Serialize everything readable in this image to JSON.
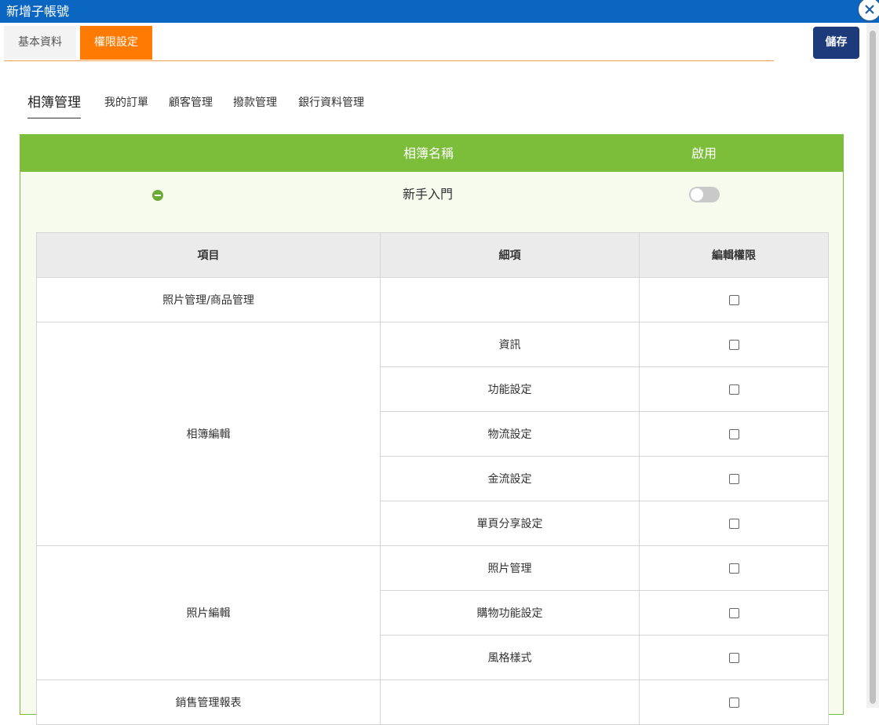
{
  "window": {
    "title": "新增子帳號"
  },
  "tabs": [
    {
      "label": "基本資料",
      "active": false
    },
    {
      "label": "權限設定",
      "active": true
    }
  ],
  "toolbar": {
    "save_label": "儲存"
  },
  "subtabs": [
    {
      "label": "相簿管理",
      "active": true
    },
    {
      "label": "我的訂單",
      "active": false
    },
    {
      "label": "顧客管理",
      "active": false
    },
    {
      "label": "撥款管理",
      "active": false
    },
    {
      "label": "銀行資料管理",
      "active": false
    }
  ],
  "album_table": {
    "header_name": "相簿名稱",
    "header_enable": "啟用",
    "album": {
      "name": "新手入門",
      "enabled": false
    }
  },
  "permissions": {
    "headers": {
      "item": "項目",
      "detail": "細項",
      "edit": "編輯權限"
    },
    "rows": [
      {
        "item": "照片管理/商品管理",
        "detail": "",
        "checked": false
      },
      {
        "item": "相簿編輯",
        "detail": "資訊",
        "checked": false
      },
      {
        "item": "",
        "detail": "功能設定",
        "checked": false
      },
      {
        "item": "",
        "detail": "物流設定",
        "checked": false
      },
      {
        "item": "",
        "detail": "金流設定",
        "checked": false
      },
      {
        "item": "",
        "detail": "單頁分享設定",
        "checked": false
      },
      {
        "item": "照片編輯",
        "detail": "照片管理",
        "checked": false
      },
      {
        "item": "",
        "detail": "購物功能設定",
        "checked": false
      },
      {
        "item": "",
        "detail": "風格樣式",
        "checked": false
      },
      {
        "item": "銷售管理報表",
        "detail": "",
        "checked": false
      }
    ]
  },
  "colors": {
    "titlebar": "#0b66c2",
    "active_tab": "#ff7a00",
    "save_button": "#1d3b7a",
    "album_header": "#7cbd3a"
  }
}
